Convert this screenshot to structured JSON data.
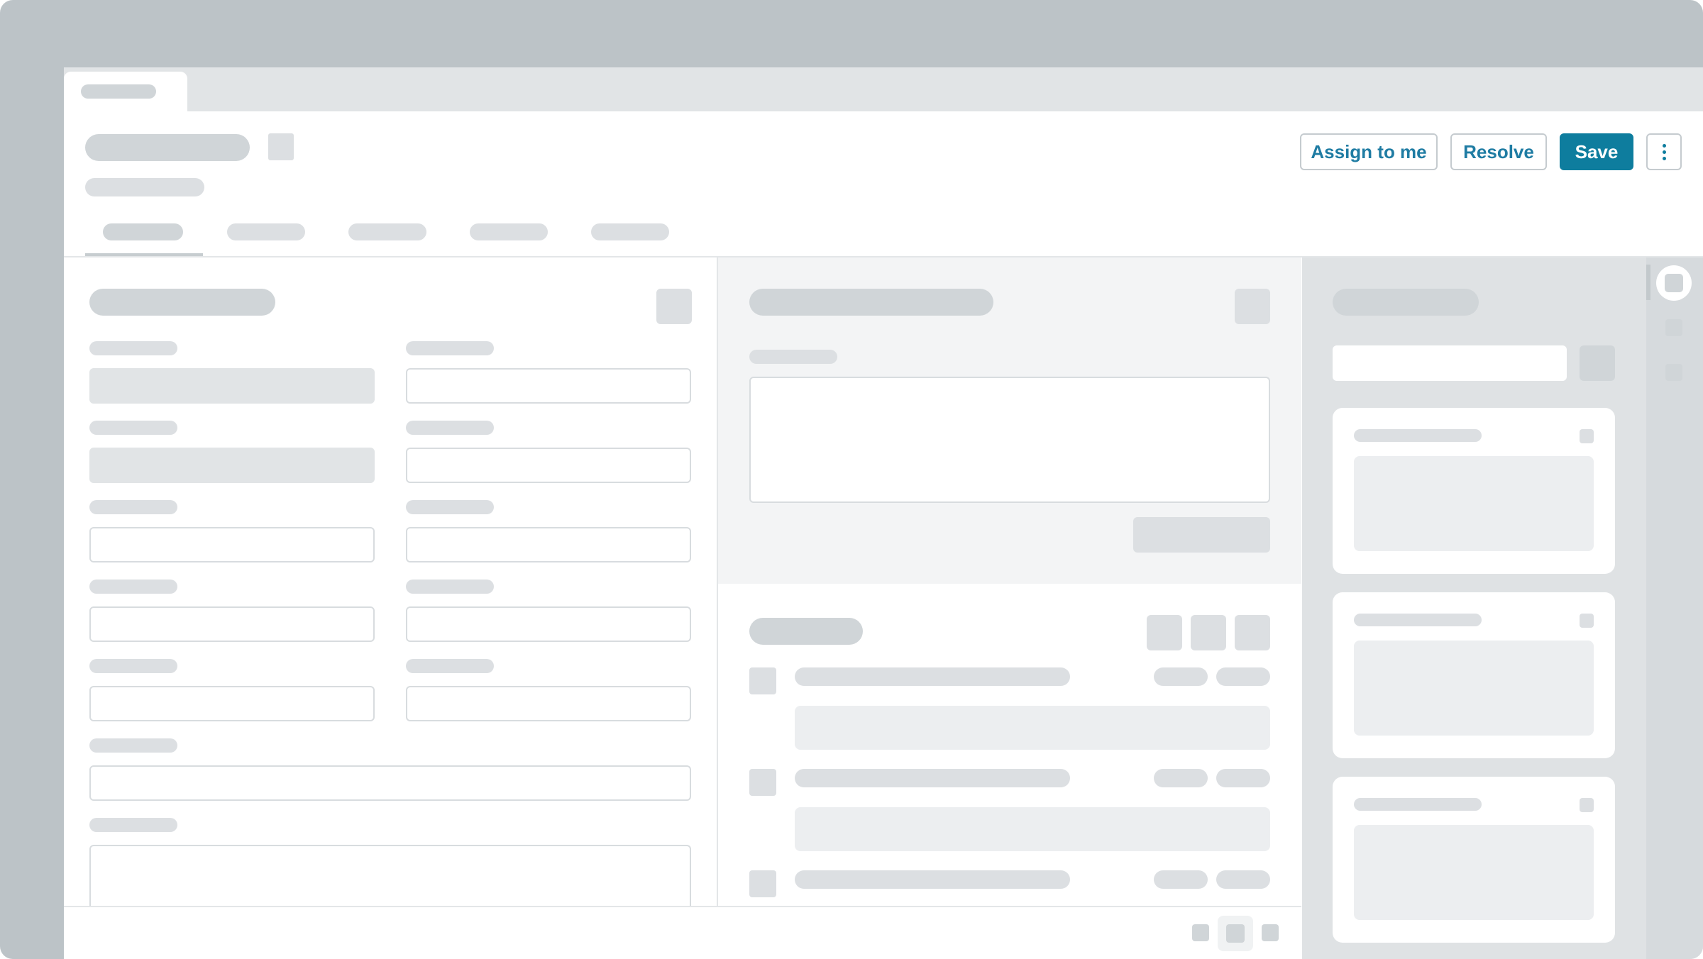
{
  "toolbar": {
    "assign_label": "Assign to me",
    "resolve_label": "Resolve",
    "save_label": "Save"
  },
  "colors": {
    "desktop": "#bcc3c7",
    "accent": "#0e7d9e",
    "skeleton": "#dcdfe2",
    "panel": "#dfe2e4"
  },
  "icons": {
    "more": "more-vertical-icon"
  }
}
